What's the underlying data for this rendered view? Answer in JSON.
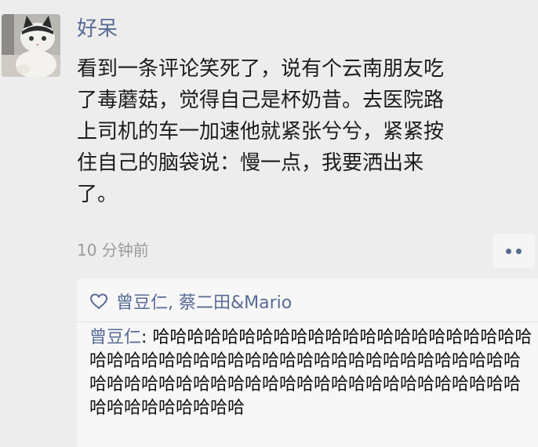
{
  "post": {
    "author": "好呆",
    "text_lines": [
      "看到一条评论笑死了，说有个云南朋友吃",
      "了毒蘑菇，觉得自己是杯奶昔。去医院路",
      "上司机的车一加速他就紧张兮兮，紧紧按",
      "住自己的脑袋说：慢一点，我要洒出来",
      "了。"
    ],
    "timestamp": "10 分钟前"
  },
  "interactions": {
    "likes": "曾豆仁, 蔡二田&Mario",
    "comments": [
      {
        "author": "曾豆仁",
        "separator": ": ",
        "text": "哈哈哈哈哈哈哈哈哈哈哈哈哈哈哈哈哈哈哈哈哈哈哈哈哈哈哈哈哈哈哈哈哈哈哈哈哈哈哈哈哈哈哈哈哈哈哈哈哈哈哈哈哈哈哈哈哈哈哈哈哈哈哈哈哈哈哈哈哈哈哈哈哈哈哈哈哈哈哈哈哈"
      }
    ]
  },
  "colors": {
    "link_blue": "#576b95",
    "timestamp_gray": "#9b9b9b",
    "background": "#ededed",
    "interaction_bg": "#f7f7f7"
  },
  "icons": {
    "like": "heart-outline-icon",
    "more": "more-dots-icon"
  }
}
